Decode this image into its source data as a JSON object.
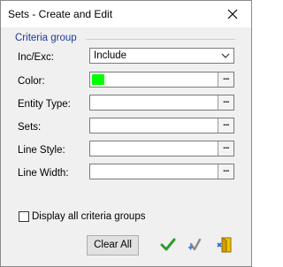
{
  "window": {
    "title": "Sets - Create and Edit"
  },
  "criteria_group": {
    "label": "Criteria group",
    "inc_exc": {
      "label": "Inc/Exc:",
      "value": "Include"
    },
    "color": {
      "label": "Color:",
      "value_hex": "#00ff00"
    },
    "entity_type": {
      "label": "Entity Type:"
    },
    "sets": {
      "label": "Sets:"
    },
    "line_style": {
      "label": "Line Style:"
    },
    "line_width": {
      "label": "Line Width:"
    },
    "browse_label": "..."
  },
  "display_all": {
    "label": "Display all criteria groups",
    "checked": false
  },
  "buttons": {
    "clear_all": "Clear All",
    "ok_icon": "checkmark-icon",
    "apply_icon": "apply-icon",
    "exit_icon": "exit-icon"
  }
}
